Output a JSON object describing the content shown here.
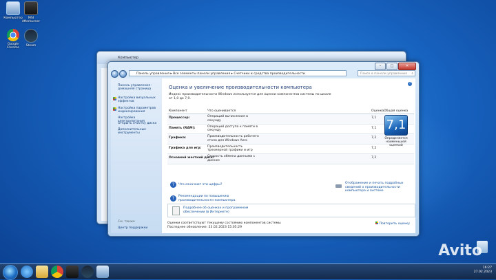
{
  "desktop": {
    "icons": [
      {
        "label": "Компьютер",
        "icon": "computer-icon"
      },
      {
        "label": "MSI Afterburner",
        "icon": "msi-afterburner-icon"
      },
      {
        "label": "Google Chrome",
        "icon": "chrome-icon"
      },
      {
        "label": "Steam",
        "icon": "steam-icon"
      }
    ]
  },
  "back_window": {
    "title": "Компьютер"
  },
  "window": {
    "address": "Панель управления ▸ Все элементы панели управления ▸ Счетчики и средства производительности",
    "search_placeholder": "Поиск в панели управления",
    "controls": {
      "min": "–",
      "max": "□",
      "close": "✕"
    }
  },
  "sidebar": {
    "items": [
      "Панель управления - домашняя страница",
      "Настройка визуальных эффектов",
      "Настройка параметров индексирования",
      "Настройка электропитания",
      "Открыть очистку диска",
      "Дополнительные инструменты"
    ],
    "see_also": "См. также",
    "action_center": "Центр поддержки"
  },
  "main": {
    "title": "Оценка и увеличение производительности компьютера",
    "description": "Индекс производительности Windows используется для оценки компонентов системы по шкале от 1,0 до 7,9.",
    "table": {
      "headers": {
        "component": "Компонент",
        "rated": "Что оценивается",
        "score": "Оценка",
        "overall": "Общая оценка"
      },
      "rows": [
        {
          "component": "Процессор:",
          "desc": "Операций вычисления в секунду",
          "score": "7,1"
        },
        {
          "component": "Память (RAM):",
          "desc": "Операций доступа к памяти в секунду",
          "score": "7,1"
        },
        {
          "component": "Графика:",
          "desc": "Производительность рабочего стола для Windows Aero",
          "score": "7,2"
        },
        {
          "component": "Графика для игр:",
          "desc": "Производительность трехмерной графики и игр",
          "score": "7,2"
        },
        {
          "component": "Основной жесткий диск:",
          "desc": "Скорость обмена данными с диском",
          "score": "7,2"
        }
      ],
      "base_score": "7,1",
      "base_caption": "Определяется наименьшей оценкой"
    },
    "links": {
      "what_means": "Что означают эти цифры?",
      "tips": "Рекомендации по повышению производительности компьютера.",
      "print": "Отображение и печать подробных сведений о производительности компьютера и системе"
    },
    "online_info": "Подробнее об оценках и программном обеспечении (в Интернете)",
    "status_line1": "Оценки соответствуют текущему состоянию компонентов системы",
    "status_line2": "Последнее обновление: 23.02.2023 15:05:29",
    "repeat": "Повторить оценку"
  },
  "taskbar": {
    "time": "16:27",
    "date": "27.02.2023"
  },
  "watermark": "Avito"
}
